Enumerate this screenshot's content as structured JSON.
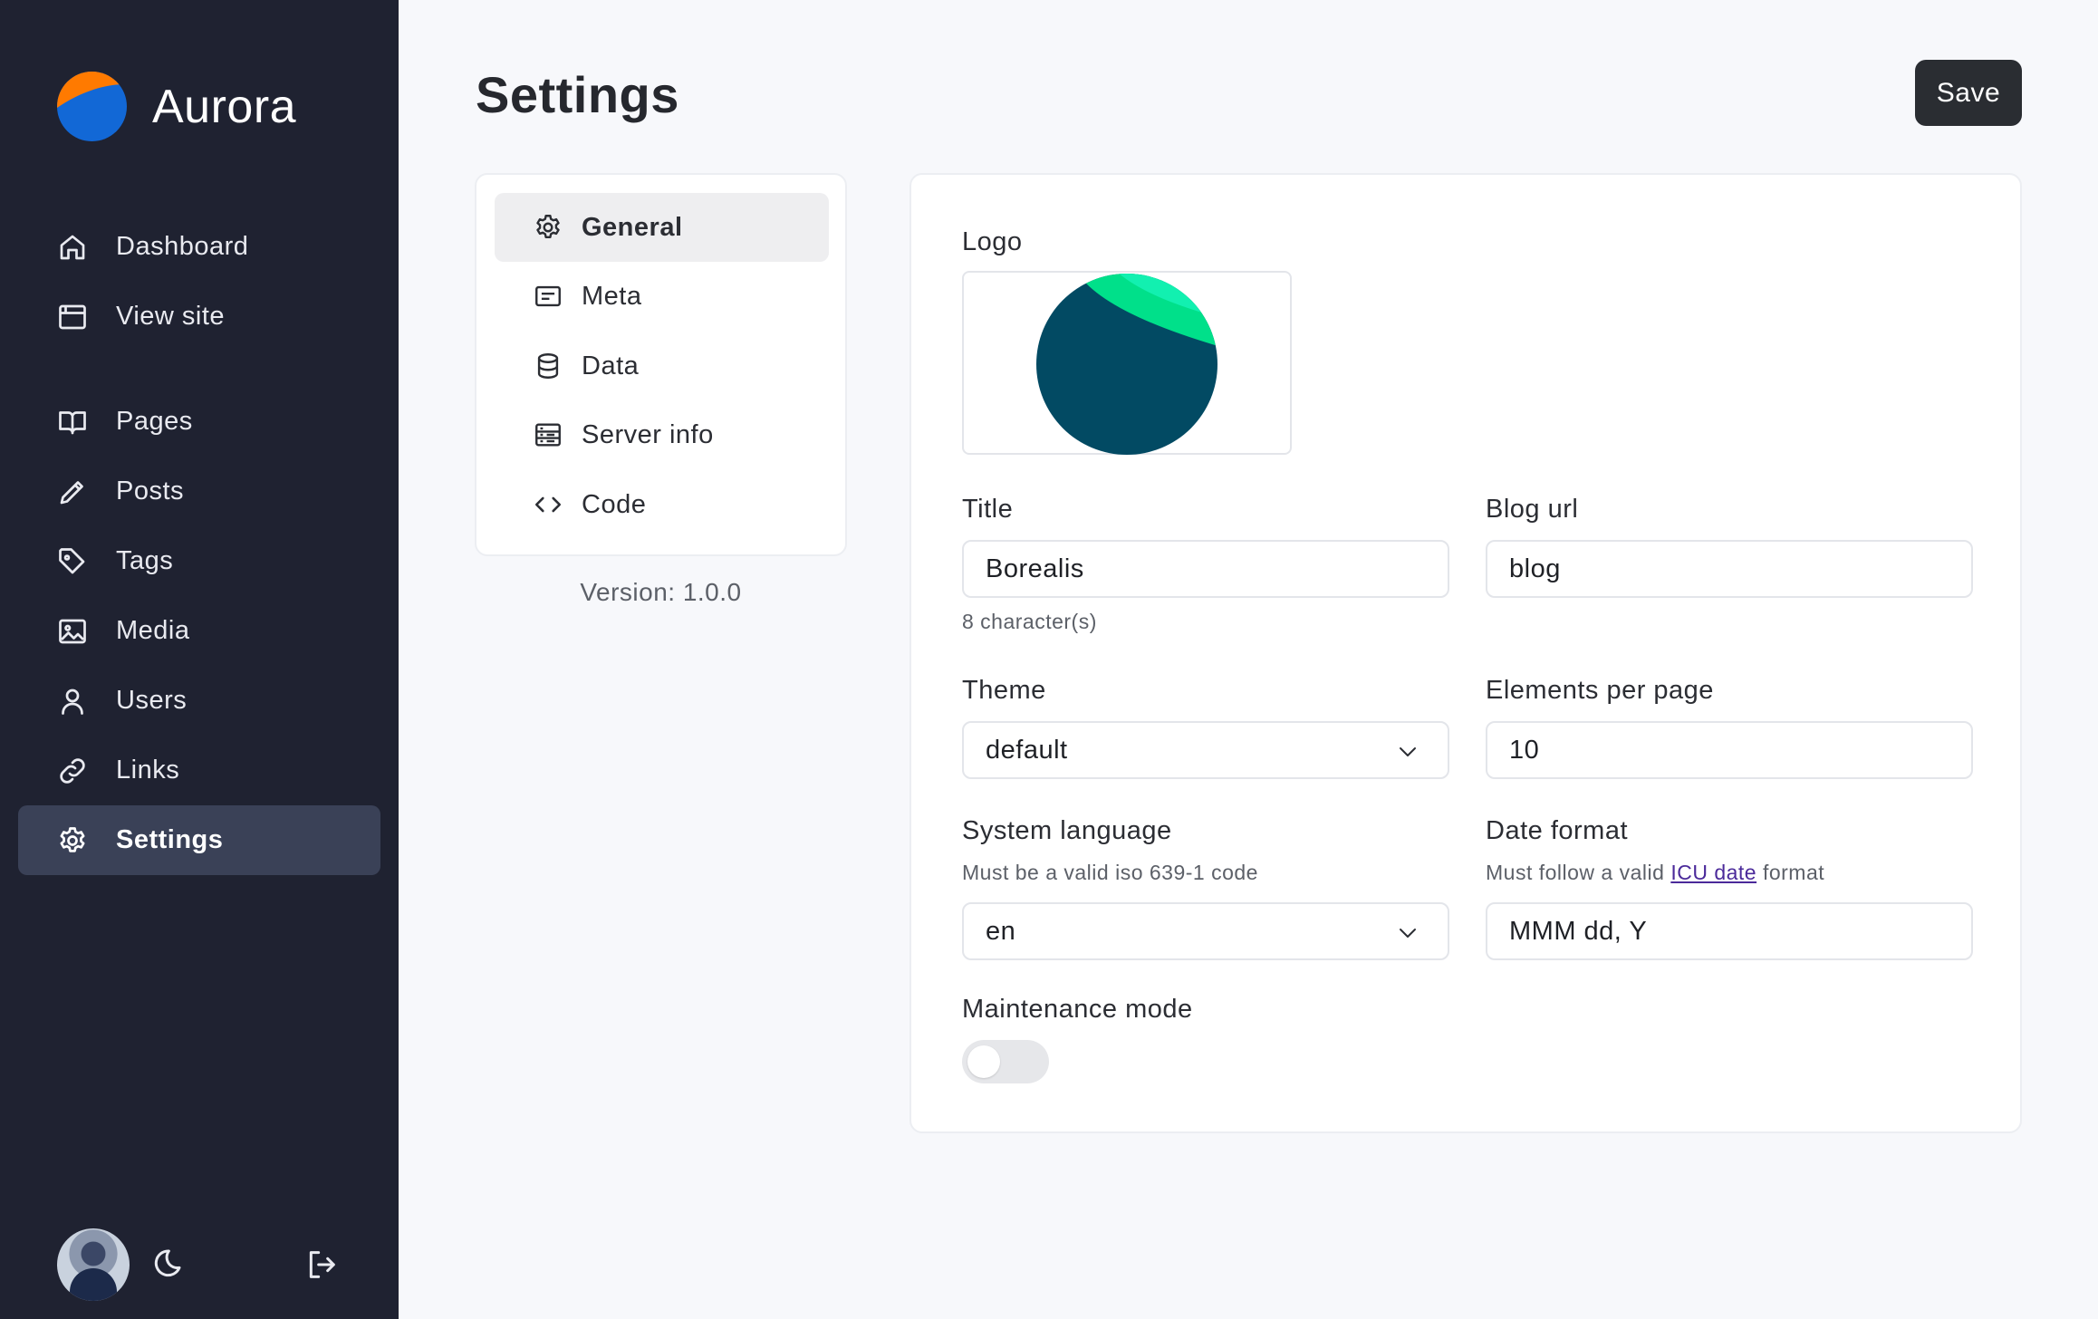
{
  "brand": {
    "name": "Aurora"
  },
  "sidebar": {
    "items": [
      {
        "label": "Dashboard",
        "icon": "home-icon"
      },
      {
        "label": "View site",
        "icon": "browser-window-icon"
      },
      {
        "label": "Pages",
        "icon": "book-open-icon"
      },
      {
        "label": "Posts",
        "icon": "pencil-icon"
      },
      {
        "label": "Tags",
        "icon": "tag-icon"
      },
      {
        "label": "Media",
        "icon": "image-icon"
      },
      {
        "label": "Users",
        "icon": "user-icon"
      },
      {
        "label": "Links",
        "icon": "link-icon"
      },
      {
        "label": "Settings",
        "icon": "gear-icon",
        "active": true
      }
    ]
  },
  "header": {
    "title": "Settings",
    "save_label": "Save"
  },
  "settings_nav": {
    "items": [
      {
        "label": "General",
        "icon": "gear-icon",
        "active": true
      },
      {
        "label": "Meta",
        "icon": "card-text-icon"
      },
      {
        "label": "Data",
        "icon": "database-icon"
      },
      {
        "label": "Server info",
        "icon": "server-icon"
      },
      {
        "label": "Code",
        "icon": "code-icon"
      }
    ],
    "version": "Version: 1.0.0"
  },
  "form": {
    "logo_label": "Logo",
    "title_label": "Title",
    "title_value": "Borealis",
    "title_hint": "8 character(s)",
    "blog_url_label": "Blog url",
    "blog_url_value": "blog",
    "theme_label": "Theme",
    "theme_value": "default",
    "elements_label": "Elements per page",
    "elements_value": "10",
    "language_label": "System language",
    "language_hint": "Must be a valid iso 639-1 code",
    "language_value": "en",
    "date_format_label": "Date format",
    "date_hint_prefix": "Must follow a valid",
    "date_hint_link": "ICU date",
    "date_hint_suffix": "format",
    "date_format_value": "MMM dd, Y",
    "maintenance_label": "Maintenance mode",
    "maintenance_on": false
  },
  "colors": {
    "sidebar_bg": "#1f2231",
    "sidebar_active": "#3a4157",
    "page_bg": "#f7f8fb",
    "save_button": "#2a2d32",
    "logo_teal": "#024a63",
    "logo_green": "#00e08a",
    "brand_orange": "#ff7a00",
    "brand_blue": "#1268d6"
  }
}
